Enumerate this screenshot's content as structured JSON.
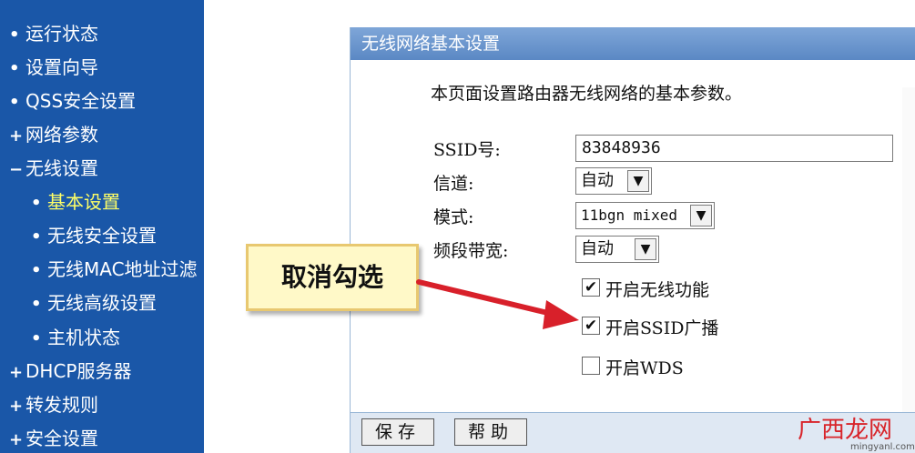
{
  "sidebar": {
    "items": [
      {
        "marker": "•",
        "label": "运行状态",
        "level": 0
      },
      {
        "marker": "•",
        "label": "设置向导",
        "level": 0
      },
      {
        "marker": "•",
        "label": "QSS安全设置",
        "level": 0
      },
      {
        "marker": "+",
        "label": "网络参数",
        "level": 0
      },
      {
        "marker": "−",
        "label": "无线设置",
        "level": 0
      },
      {
        "marker": "•",
        "label": "基本设置",
        "level": 1
      },
      {
        "marker": "•",
        "label": "无线安全设置",
        "level": 1
      },
      {
        "marker": "•",
        "label": "无线MAC地址过滤",
        "level": 1
      },
      {
        "marker": "•",
        "label": "无线高级设置",
        "level": 1
      },
      {
        "marker": "•",
        "label": "主机状态",
        "level": 1
      },
      {
        "marker": "+",
        "label": "DHCP服务器",
        "level": 0
      },
      {
        "marker": "+",
        "label": "转发规则",
        "level": 0
      },
      {
        "marker": "+",
        "label": "安全设置",
        "level": 0
      }
    ]
  },
  "panel": {
    "title": "无线网络基本设置",
    "description": "本页面设置路由器无线网络的基本参数。",
    "ssid_label": "SSID号:",
    "ssid_value": "83848936",
    "channel_label": "信道:",
    "channel_value": "自动",
    "mode_label": "模式:",
    "mode_value": "11bgn mixed",
    "bandwidth_label": "频段带宽:",
    "bandwidth_value": "自动",
    "checkboxes": [
      {
        "label": "开启无线功能",
        "checked": true
      },
      {
        "label": "开启SSID广播",
        "checked": true
      },
      {
        "label": "开启WDS",
        "checked": false
      }
    ],
    "save_label": "保存",
    "help_label": "帮助"
  },
  "callout": {
    "text": "取消勾选"
  },
  "watermark": {
    "text": "广西龙网",
    "url": "mingyanl.com"
  },
  "colors": {
    "sidebar_bg": "#1a57a8",
    "header_bg": "#5b88c4",
    "callout_bg": "#fff9c8",
    "arrow": "#d8202a"
  }
}
